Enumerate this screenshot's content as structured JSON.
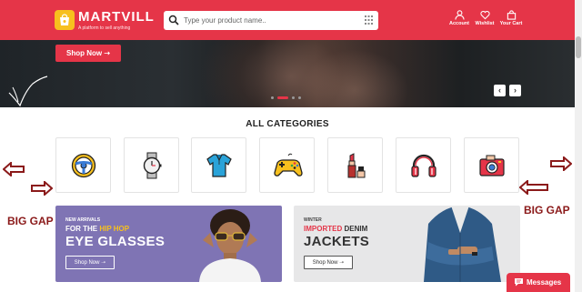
{
  "header": {
    "brand_name": "MARTVILL",
    "brand_tagline": "A platform to sell anything",
    "search_placeholder": "Type your product name..",
    "actions": [
      {
        "label": "Account",
        "icon": "user-icon"
      },
      {
        "label": "Wishlist",
        "icon": "heart-icon"
      },
      {
        "label": "Your Cart",
        "icon": "cart-icon"
      }
    ]
  },
  "hero": {
    "cta_label": "Shop Now ➝",
    "prev_label": "‹",
    "next_label": "›",
    "active_slide": 2,
    "slide_count": 4
  },
  "categories": {
    "title": "ALL CATEGORIES",
    "items": [
      {
        "icon": "steering-wheel-icon"
      },
      {
        "icon": "wristwatch-icon"
      },
      {
        "icon": "polo-shirt-icon"
      },
      {
        "icon": "game-controller-icon"
      },
      {
        "icon": "lipstick-icon"
      },
      {
        "icon": "headphones-icon"
      },
      {
        "icon": "camera-icon"
      }
    ]
  },
  "annotations": {
    "left_label": "BIG GAP",
    "right_label": "BIG GAP",
    "color": "#8b1a1a"
  },
  "banners": {
    "left": {
      "small": "NEW ARRIVALS",
      "line2_prefix": "FOR THE ",
      "line2_highlight": "HIP HOP",
      "big": "EYE GLASSES",
      "button": "Shop Now ➝"
    },
    "right": {
      "small": "WINTER",
      "line2_highlight": "IMPORTED",
      "line2_suffix": " DENIM",
      "big": "JACKETS",
      "button": "Shop Now ➝"
    }
  },
  "messages": {
    "label": "Messages"
  },
  "colors": {
    "brand_red": "#e53548",
    "logo_yellow": "#f7c01e",
    "banner_purple": "#7f74b4"
  }
}
